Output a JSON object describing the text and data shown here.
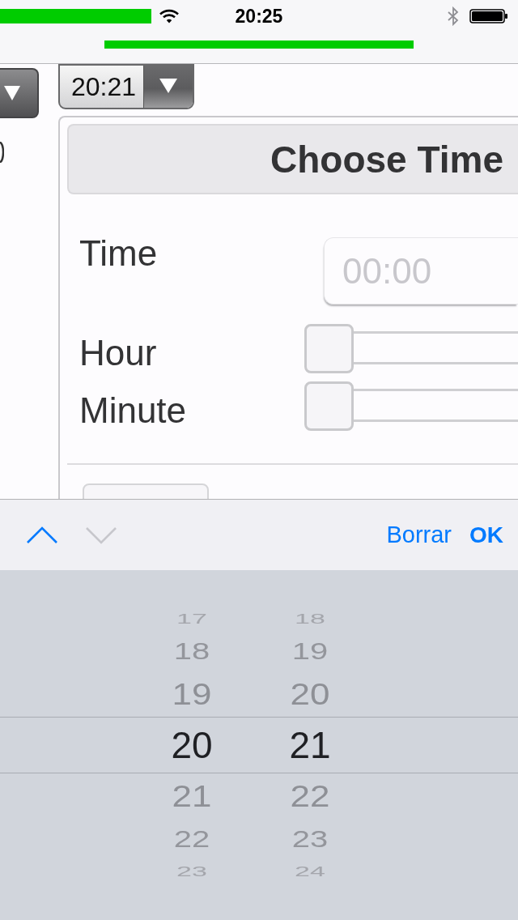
{
  "status_bar": {
    "time": "20:25"
  },
  "page": {
    "time_select": {
      "value": "20:21"
    },
    "dialog": {
      "title": "Choose Time",
      "time_field": {
        "label": "Time",
        "placeholder": "00:00"
      },
      "sliders": [
        {
          "label": "Hour",
          "level": 0
        },
        {
          "label": "Minute",
          "level": 0
        }
      ]
    }
  },
  "toolbar": {
    "arrows": [
      {
        "kind": "up",
        "disabled": false
      },
      {
        "kind": "down",
        "disabled": true
      }
    ],
    "buttons": [
      {
        "label": "Borrar",
        "kind": "plain"
      },
      {
        "label": "OK",
        "kind": "done"
      }
    ]
  },
  "picker": {
    "columns": [
      {
        "items": [
          {
            "label": "17",
            "selected": false
          },
          {
            "label": "18",
            "selected": false
          },
          {
            "label": "19",
            "selected": false
          },
          {
            "label": "20",
            "selected": true
          },
          {
            "label": "21",
            "selected": false
          },
          {
            "label": "22",
            "selected": false
          },
          {
            "label": "23",
            "selected": false
          }
        ]
      },
      {
        "items": [
          {
            "label": "18",
            "selected": false
          },
          {
            "label": "19",
            "selected": false
          },
          {
            "label": "20",
            "selected": false
          },
          {
            "label": "21",
            "selected": true
          },
          {
            "label": "22",
            "selected": false
          },
          {
            "label": "23",
            "selected": false
          },
          {
            "label": "24",
            "selected": false
          }
        ]
      }
    ]
  }
}
